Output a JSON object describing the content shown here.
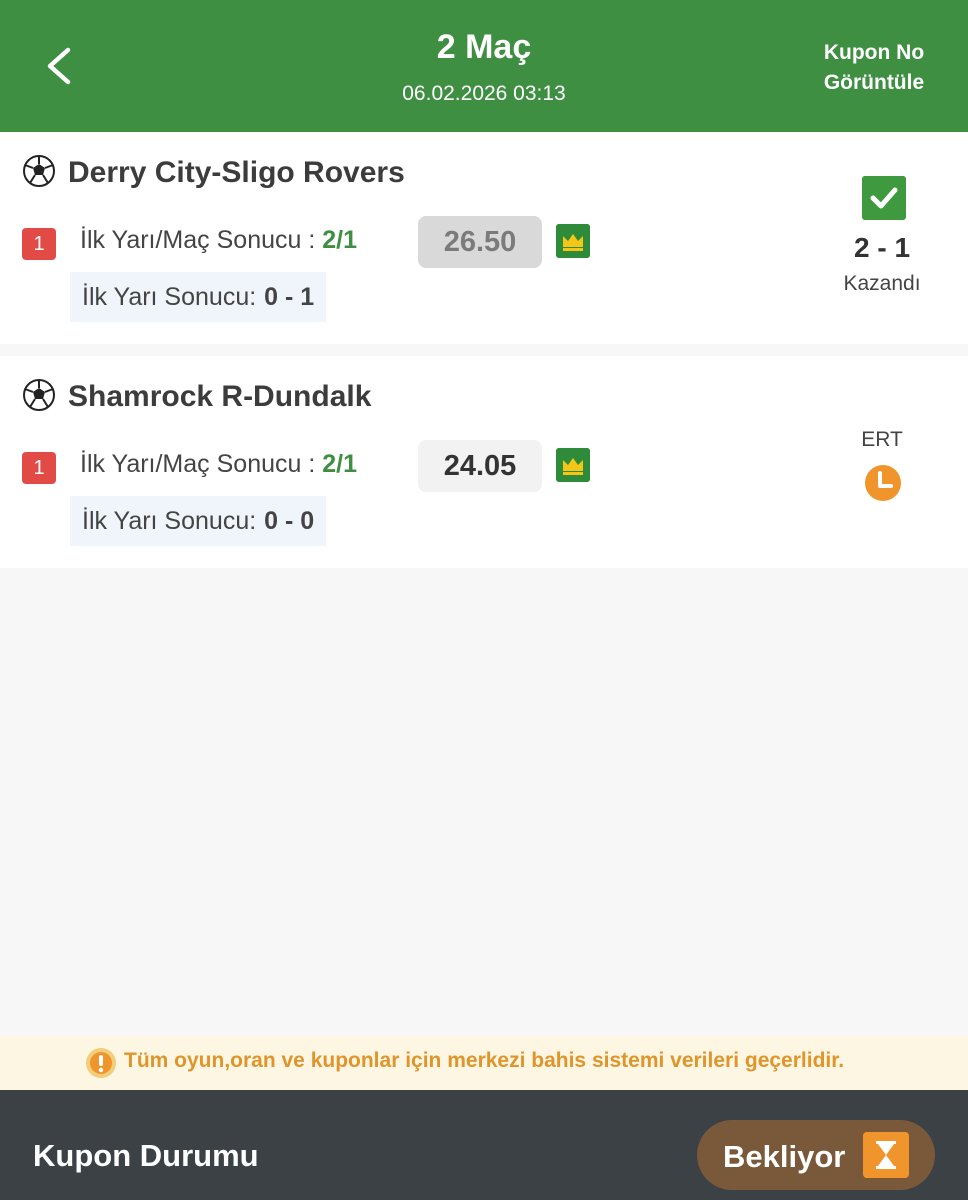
{
  "header": {
    "title": "2 Maç",
    "datetime": "06.02.2026 03:13",
    "kupon_no_line1": "Kupon No",
    "kupon_no_line2": "Görüntüle"
  },
  "matches": [
    {
      "name": "Derry City-Sligo Rovers",
      "number": "1",
      "market_label": "İlk Yarı/Maç Sonucu : ",
      "pick": "2/1",
      "odds": "26.50",
      "ht_label": "İlk Yarı Sonucu:",
      "ht_score": "0 - 1",
      "final_score": "2 - 1",
      "status": "Kazandı"
    },
    {
      "name": "Shamrock R-Dundalk",
      "number": "1",
      "market_label": "İlk Yarı/Maç Sonucu : ",
      "pick": "2/1",
      "odds": "24.05",
      "ht_label": "İlk Yarı Sonucu:",
      "ht_score": "0 - 0",
      "status": "ERT"
    }
  ],
  "notice": "Tüm oyun,oran ve kuponlar için merkezi bahis sistemi verileri geçerlidir.",
  "footer": {
    "label": "Kupon Durumu",
    "status": "Bekliyor"
  },
  "icons": {
    "back": "chevron-left-icon",
    "ball": "soccer-ball-icon",
    "crown": "crown-icon",
    "won": "check-icon",
    "pending": "clock-icon",
    "notice": "exclamation-icon",
    "status": "hourglass-icon"
  },
  "colors": {
    "header_green": "#3f8f43",
    "pick_green": "#3f8f43",
    "badge_red": "#e24a45",
    "notice_orange": "#e0952a",
    "footer_dark": "#3b4145",
    "pill_brown": "#79593a",
    "clock_orange": "#f0952b"
  }
}
